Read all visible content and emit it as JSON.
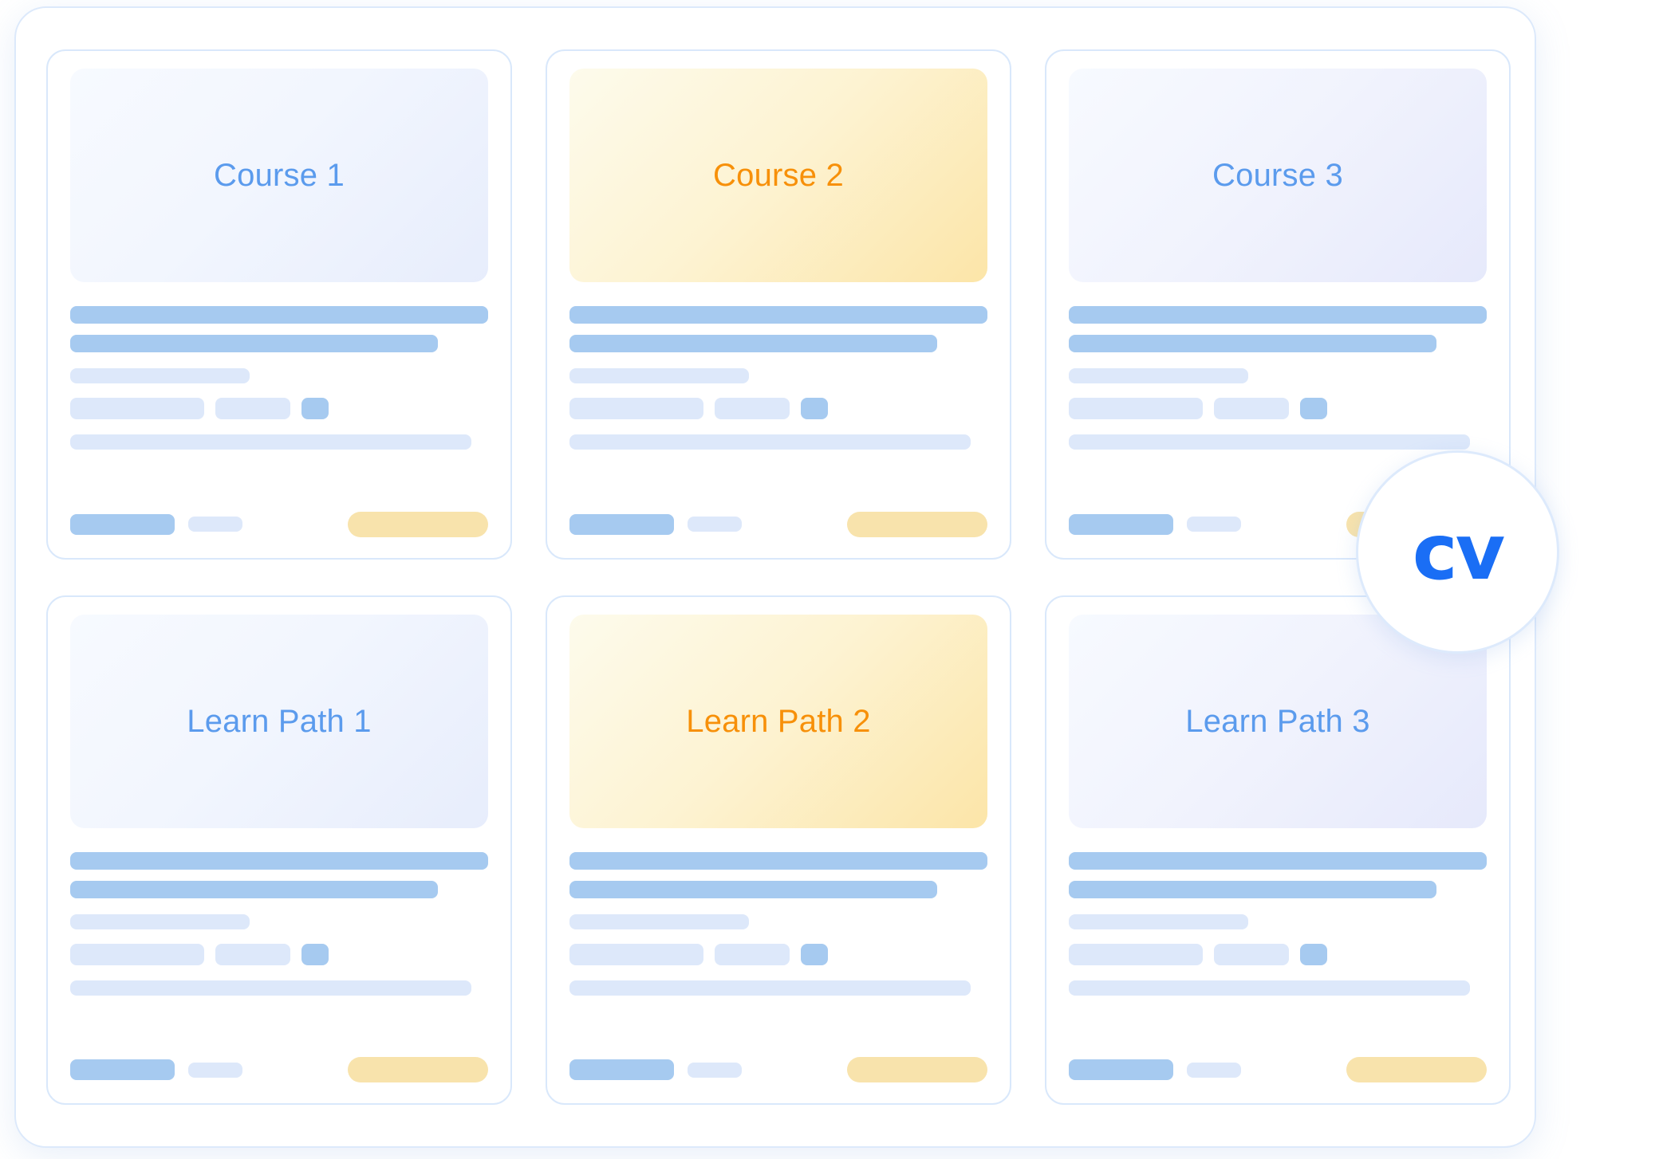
{
  "panel": {
    "name": "course-catalog-panel"
  },
  "badge": {
    "label": "cv",
    "color": "#1a6ef5",
    "border_color": "#ddeafc"
  },
  "theme": {
    "panel_border": "#dce9fb",
    "card_border": "#d9e8fb",
    "skeleton_strong": "#a6caf0",
    "skeleton_faint": "#dde8fa",
    "skeleton_gold": "#f8e3ac",
    "title_blue": "#5b9bed",
    "title_gold": "#f79009"
  },
  "cards": [
    {
      "title": "Course 1",
      "thumb_style": "blue",
      "title_style": "t-blue",
      "footer_cta_style": "gold"
    },
    {
      "title": "Course 2",
      "thumb_style": "gold",
      "title_style": "t-gold",
      "footer_cta_style": "gold"
    },
    {
      "title": "Course 3",
      "thumb_style": "violet",
      "title_style": "t-blue",
      "footer_cta_style": "gold"
    },
    {
      "title": "Learn Path 1",
      "thumb_style": "blue",
      "title_style": "t-blue",
      "footer_cta_style": "gold"
    },
    {
      "title": "Learn Path 2",
      "thumb_style": "gold",
      "title_style": "t-gold",
      "footer_cta_style": "gold"
    },
    {
      "title": "Learn Path 3",
      "thumb_style": "violet",
      "title_style": "t-blue",
      "footer_cta_style": "gold"
    }
  ]
}
